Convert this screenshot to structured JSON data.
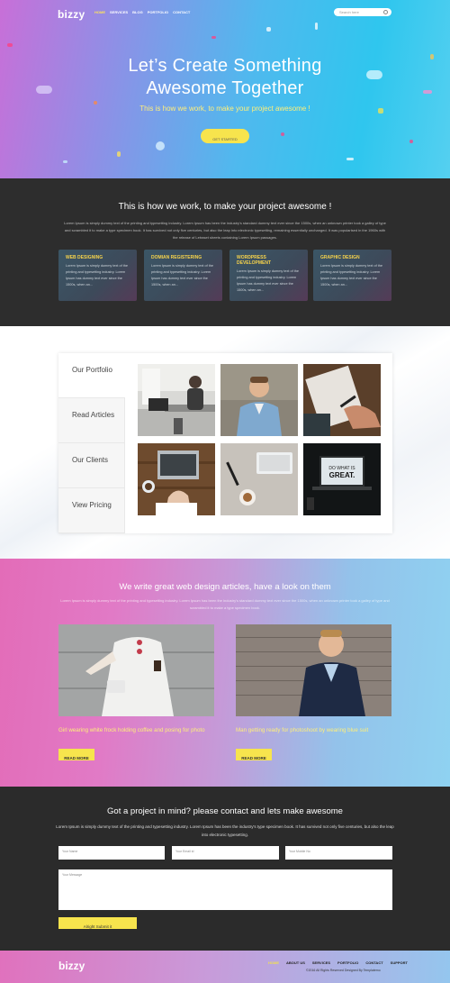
{
  "brand": {
    "logo": "bizzy"
  },
  "nav": {
    "items": [
      {
        "label": "HOME",
        "active": true
      },
      {
        "label": "SERVICES",
        "active": false
      },
      {
        "label": "BLOG",
        "active": false
      },
      {
        "label": "PORTFOLIO",
        "active": false
      },
      {
        "label": "CONTACT",
        "active": false
      }
    ],
    "search_placeholder": "Search here"
  },
  "hero": {
    "title_line1": "Let’s Create Something",
    "title_line2": "Awesome Together",
    "subtitle": "This is how we work, to make your project awesome !",
    "cta_label": "GET STARTED"
  },
  "work": {
    "heading": "This is how we work, to make your project awesome !",
    "lead": "Lorem Ipsum is simply dummy text of the printing and typesetting industry. Lorem Ipsum has been the industry's standard dummy text ever since the 1500s, when an unknown printer took a galley of type and scrambled it to make a type specimen book. It has survived not only five centuries, but also the leap into electronic typesetting, remaining essentially unchanged. It was popularised in the 1960s with the release of Letraset sheets containing Lorem Ipsum passages.",
    "services": [
      {
        "title": "WEB DESIGNING",
        "text": "Lorem Ipsum is simply dummy text of the printing and typesetting industry. Lorem Ipsum has dummy text ever since the 1500s, when an..."
      },
      {
        "title": "DOMIAN REGISTERING",
        "text": "Lorem Ipsum is simply dummy text of the printing and typesetting industry. Lorem Ipsum has dummy text ever since the 1500s, when an..."
      },
      {
        "title": "WORDPRESS DEVELOPMENT",
        "text": "Lorem Ipsum is simply dummy text of the printing and typesetting industry. Lorem Ipsum has dummy text ever since the 1500s, when an..."
      },
      {
        "title": "GRAPHIC DESIGN",
        "text": "Lorem Ipsum is simply dummy text of the printing and typesetting industry. Lorem Ipsum has dummy text ever since the 1500s, when an..."
      }
    ]
  },
  "portfolio": {
    "tabs": [
      "Our Portfolio",
      "Read Articles",
      "Our Clients",
      "View Pricing"
    ],
    "laptop_screen_text": "DO WHAT IS GREAT."
  },
  "articles": {
    "heading": "We write great web design articles, have a look on them",
    "lead": "Lorem Ipsum is simply dummy text of the printing and typesetting industry. Lorem Ipsum has been the industry's standard dummy text ever since the 1500s, when an unknown printer took a galley of type and scrambled it to make a type specimen book.",
    "items": [
      {
        "caption": "Girl wearing white frock holding coffee and posing for photo",
        "button": "READ MORE"
      },
      {
        "caption": "Man getting ready for photoshoot by wearing blue suit",
        "button": "READ MORE"
      }
    ]
  },
  "contact": {
    "heading": "Got a project in mind? please contact and lets make awesome",
    "lead": "Lorem Ipsum is simply dummy text of the printing and typesetting industry. Lorem Ipsum has been the industry's type specimen book. It has survived not only five centuries, but also the leap into electronic typesetting.",
    "fields": {
      "name": "Your Name",
      "email": "Your Email id",
      "mobile": "Your Mobile No",
      "message": "Your Message"
    },
    "submit": "Alright Submit it"
  },
  "footer": {
    "logo": "bizzy",
    "links": [
      {
        "label": "HOME",
        "active": true
      },
      {
        "label": "ABOUT US",
        "active": false
      },
      {
        "label": "SERVICES",
        "active": false
      },
      {
        "label": "PORTFOLIO",
        "active": false
      },
      {
        "label": "CONTACT",
        "active": false
      },
      {
        "label": "SUPPORT",
        "active": false
      }
    ],
    "copyright": "©2016 All Rights Reserved Designed By Templatemo"
  },
  "colors": {
    "accent_yellow": "#f7e44d",
    "dark_bg": "#2b2b2b"
  }
}
